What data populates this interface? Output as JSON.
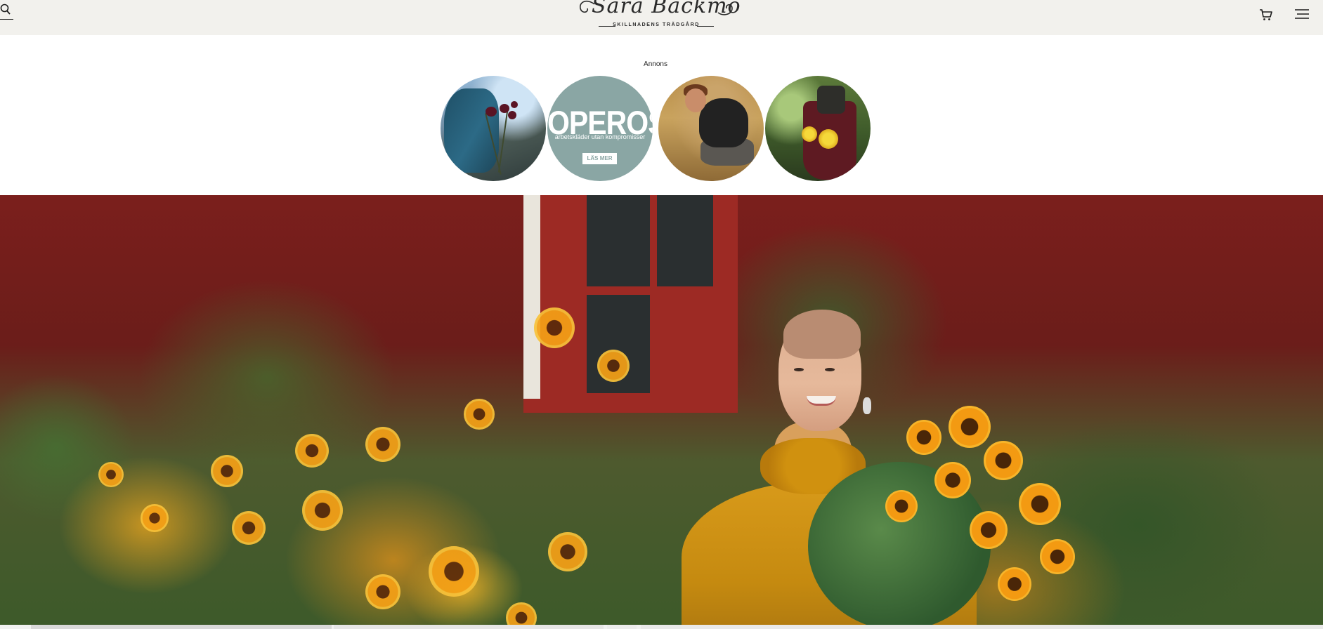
{
  "header": {
    "logo_script": "Sara Bäckmo",
    "logo_tagline": "SKILLNADENS TRÄDGÅRD",
    "background": "#f2f1ed"
  },
  "icons": {
    "search": "search-icon",
    "cart": "cart-icon",
    "menu": "hamburger-menu-icon"
  },
  "ads": {
    "label": "Annons",
    "items": [
      {
        "name": "ad-knit-sweater-flowers",
        "kind": "photo"
      },
      {
        "name": "ad-operose",
        "title": "OPEROSE",
        "subtitle": "arbetskläder utan kompromisser",
        "cta": "LÄS MER",
        "background": "#8aa6a4"
      },
      {
        "name": "ad-gardener-in-field",
        "kind": "photo"
      },
      {
        "name": "ad-tool-bag-dahlias",
        "kind": "photo"
      }
    ]
  },
  "hero": {
    "kind": "photo",
    "subject": "woman-in-mustard-sweater-with-sunflower-bouquet"
  }
}
